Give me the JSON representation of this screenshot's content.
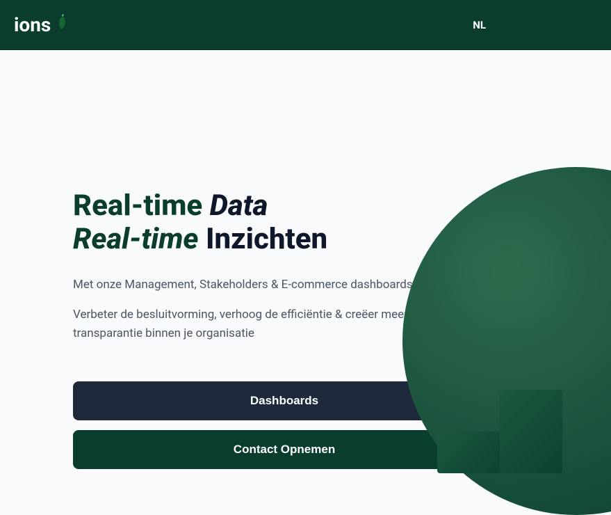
{
  "navbar": {
    "logo_text": "ions",
    "language": "NL"
  },
  "hero": {
    "heading_part1": "Real-time",
    "heading_part2": "Data",
    "heading_part3": "Real-time",
    "heading_part4": "Inzichten",
    "subtitle": "Met onze Management, Stakeholders & E-commerce dashboards.",
    "description": "Verbeter de besluitvorming, verhoog de efficiëntie & creëer meer transparantie binnen je organisatie",
    "button_dashboards": "Dashboards",
    "button_contact": "Contact Opnemen"
  }
}
